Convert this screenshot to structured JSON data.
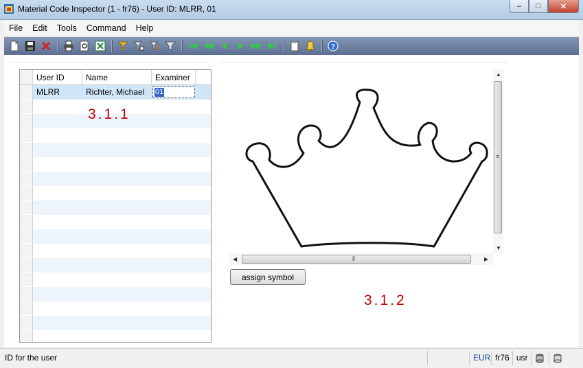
{
  "window": {
    "title": "Material Code Inspector (1 - fr76) - User ID: MLRR, 01",
    "minimize": "–",
    "maximize": "□",
    "close": "✕"
  },
  "menu": [
    "File",
    "Edit",
    "Tools",
    "Command",
    "Help"
  ],
  "toolbar_icons": [
    "new-document-icon",
    "save-icon",
    "delete-icon",
    "print-icon",
    "print-preview-icon",
    "export-excel-icon",
    "filter-quick-icon",
    "filter-selection-icon",
    "filter-advanced-icon",
    "filter-icon",
    "first-record-icon",
    "previous-page-icon",
    "previous-record-icon",
    "next-record-icon",
    "next-page-icon",
    "last-record-icon",
    "attachment-icon",
    "alert-bell-icon",
    "help-icon"
  ],
  "grid": {
    "columns": [
      "User ID",
      "Name",
      "Examiner"
    ],
    "rows": [
      {
        "user_id": "MLRR",
        "name": "Richter, Michael",
        "examiner": "01"
      }
    ]
  },
  "labels": {
    "left": "3.1.1",
    "right": "3.1.2"
  },
  "buttons": {
    "assign": "assign symbol"
  },
  "status": {
    "text": "ID for the user",
    "currency": "EUR",
    "company": "fr76",
    "layer": "usr"
  },
  "colors": {
    "accent_red": "#c00000",
    "selected_row": "#cfe6f9",
    "toolbar": "#5c6f92"
  }
}
